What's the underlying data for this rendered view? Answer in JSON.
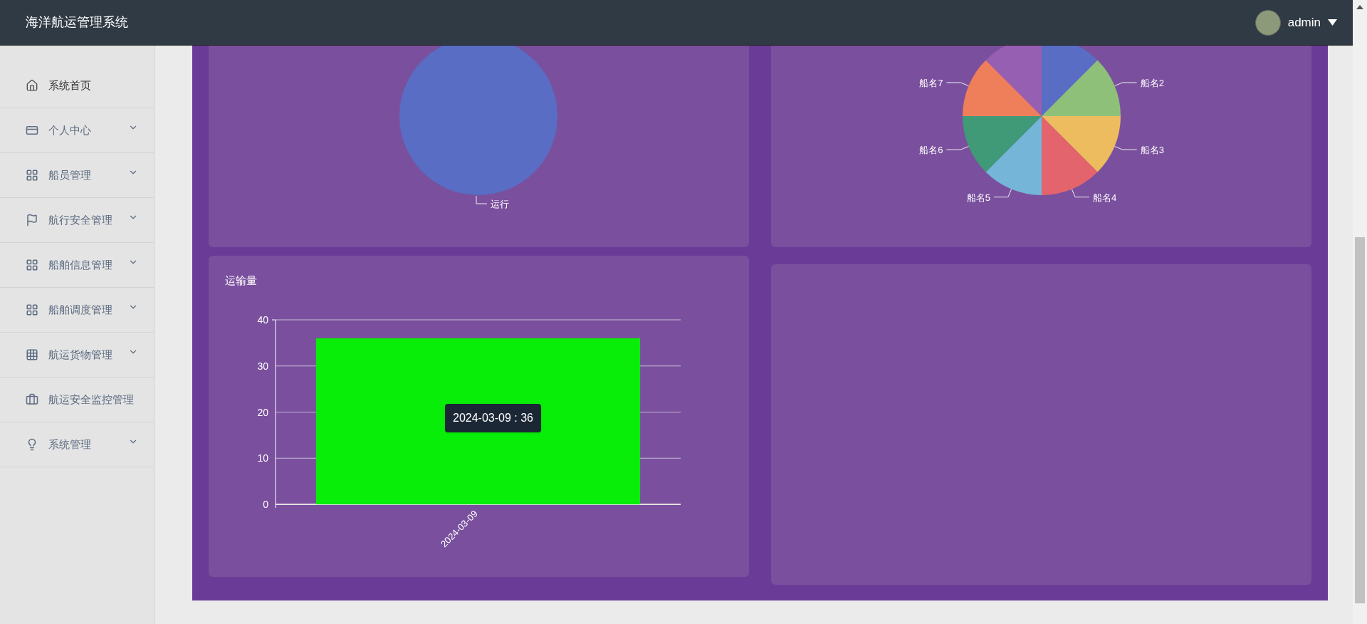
{
  "header": {
    "title": "海洋航运管理系统",
    "user": {
      "name": "admin"
    }
  },
  "sidebar": {
    "items": [
      {
        "label": "系统首页",
        "selected": true,
        "expandable": false
      },
      {
        "label": "个人中心",
        "selected": false,
        "expandable": true
      },
      {
        "label": "船员管理",
        "selected": false,
        "expandable": true
      },
      {
        "label": "航行安全管理",
        "selected": false,
        "expandable": true
      },
      {
        "label": "船舶信息管理",
        "selected": false,
        "expandable": true
      },
      {
        "label": "船舶调度管理",
        "selected": false,
        "expandable": true
      },
      {
        "label": "航运货物管理",
        "selected": false,
        "expandable": true
      },
      {
        "label": "航运安全监控管理",
        "selected": false,
        "expandable": false
      },
      {
        "label": "系统管理",
        "selected": false,
        "expandable": true
      }
    ]
  },
  "dashboard": {
    "status_pie": {
      "labels": [
        "运行"
      ]
    },
    "ship_pie": {
      "labels": [
        "船名2",
        "船名3",
        "船名4",
        "船名5",
        "船名6",
        "船名7"
      ]
    },
    "transport_chart": {
      "tooltip": "2024-03-09 : 36",
      "chart_data": {
        "type": "bar",
        "title": "运输量",
        "categories": [
          "2024-03-09"
        ],
        "values": [
          36
        ],
        "grid": true,
        "ylim": [
          0,
          40
        ],
        "yticks": [
          0,
          10,
          20,
          30,
          40
        ]
      }
    }
  }
}
